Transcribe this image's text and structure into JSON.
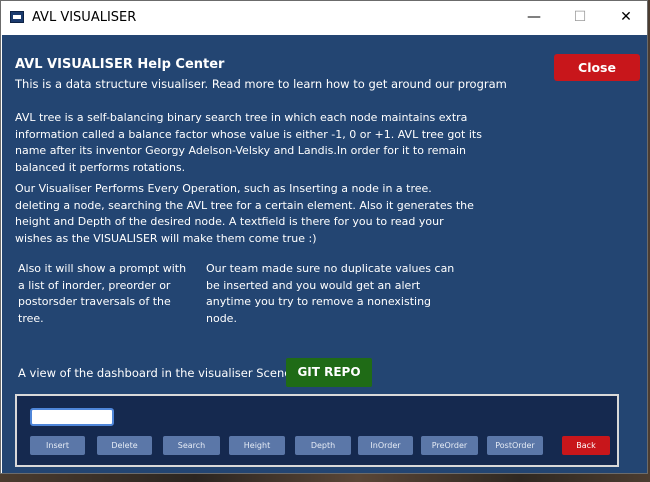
{
  "window": {
    "title": "AVL VISUALISER",
    "controls": {
      "minimize": "—",
      "maximize": "☐",
      "close": "✕"
    }
  },
  "help": {
    "heading": "AVL VISUALISER Help Center",
    "intro": "This is a data structure visualiser. Read more to learn how to get around our program",
    "paragraph_1": "AVL tree is a self-balancing binary search tree in which each node maintains extra information called a balance factor whose value is either -1, 0 or +1. AVL tree got its name after its inventor Georgy Adelson-Velsky and Landis.In order for it to remain balanced it performs rotations.",
    "paragraph_2": "Our Visualiser Performs Every Operation, such as Inserting a node in a tree. deleting a node, searching the AVL tree for a certain element. Also it generates the height and Depth of the desired node. A textfield is there for you to read your wishes as the VISUALISER will make them come true :)",
    "column_left": "Also it will show a prompt with a list of inorder, preorder or postorsder traversals of the tree.",
    "column_right": "Our team made sure no duplicate values can be inserted and you would get an alert anytime you try to remove a nonexisting node.",
    "close_label": "Close",
    "dashboard_caption": "A view of the dashboard in the visualiser Scene",
    "git_label": "GIT REPO"
  },
  "preview": {
    "buttons": [
      "Insert",
      "Delete",
      "Search",
      "Height",
      "Depth",
      "InOrder",
      "PreOrder",
      "PostOrder",
      "Back"
    ]
  },
  "colors": {
    "panel": "#234572",
    "close": "#c8161b",
    "git": "#1f6b16",
    "preview_bg": "#15294f",
    "preview_button": "#5b77a8"
  }
}
